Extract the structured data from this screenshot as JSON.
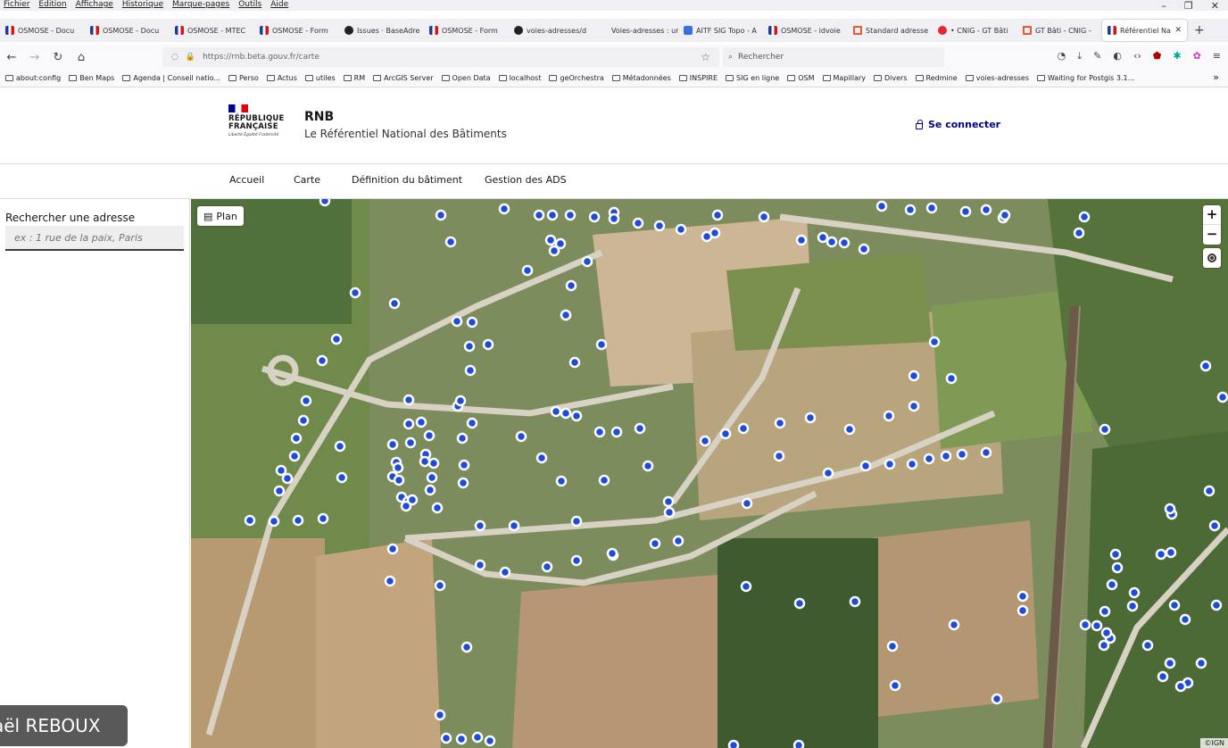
{
  "menu": [
    "Fichier",
    "Edition",
    "Affichage",
    "Historique",
    "Marque-pages",
    "Outils",
    "Aide"
  ],
  "tabs": [
    {
      "label": "OSMOSE - Docu",
      "icon": "fr"
    },
    {
      "label": "OSMOSE - Docu",
      "icon": "fr"
    },
    {
      "label": "OSMOSE - MTEC",
      "icon": "fr"
    },
    {
      "label": "OSMOSE - Form",
      "icon": "fr"
    },
    {
      "label": "Issues · BaseAdre",
      "icon": "gh"
    },
    {
      "label": "OSMOSE - Form",
      "icon": "fr"
    },
    {
      "label": "voies-adresses/d",
      "icon": "gh"
    },
    {
      "label": "Voies-adresses : une",
      "icon": "none"
    },
    {
      "label": "AITF SIG Topo - A",
      "icon": "doc"
    },
    {
      "label": "OSMOSE - idvoie",
      "icon": "fr"
    },
    {
      "label": "Standard adresse",
      "icon": "m"
    },
    {
      "label": "• CNIG - GT Bâti",
      "icon": "r"
    },
    {
      "label": "GT Bâti - CNIG - ",
      "icon": "m"
    },
    {
      "label": "Référentiel Na",
      "icon": "fr",
      "active": true
    }
  ],
  "url": "https://rnb.beta.gouv.fr/carte",
  "search_placeholder": "Rechercher",
  "bookmarks": [
    "about:config",
    "Ben Maps",
    "Agenda | Conseil natio...",
    "Perso",
    "Actus",
    "utiles",
    "RM",
    "ArcGIS Server",
    "Open Data",
    "localhost",
    "geOrchestra",
    "Métadonnées",
    "INSPIRE",
    "SIG en ligne",
    "OSM",
    "Mapillary",
    "Divers",
    "Redmine",
    "voies-adresses",
    "Waiting for Postgis 3.1..."
  ],
  "header": {
    "rf_line1": "RÉPUBLIQUE",
    "rf_line2": "FRANÇAISE",
    "devise": "Liberté Égalité Fraternité",
    "title": "RNB",
    "tagline": "Le Référentiel National des Bâtiments",
    "login": "Se connecter"
  },
  "nav": [
    "Accueil",
    "Carte",
    "Définition du bâtiment",
    "Gestion des ADS"
  ],
  "sidebar": {
    "label": "Rechercher une adresse",
    "placeholder": "ex : 1 rue de la paix, Paris"
  },
  "map": {
    "plan_label": "Plan",
    "zoom_in": "+",
    "zoom_out": "−",
    "attribution": "©IGN",
    "marker_color": "#1f4bd9"
  },
  "speaker": "aël REBOUX"
}
